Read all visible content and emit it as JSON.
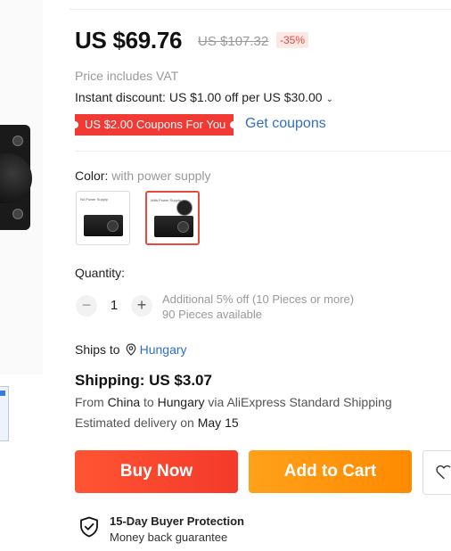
{
  "price": {
    "current": "US $69.76",
    "original": "US $107.32",
    "discount": "-35%",
    "vat_note": "Price includes VAT",
    "instant_discount": "Instant discount: US $1.00 off per US $30.00"
  },
  "coupons": {
    "tag": "US $2.00 Coupons For You",
    "link": "Get coupons"
  },
  "color": {
    "label": "Color:",
    "value": "with power supply",
    "options": [
      {
        "caption": "No Power Supply",
        "selected": false
      },
      {
        "caption": "With Power Supply",
        "selected": true
      }
    ]
  },
  "quantity": {
    "label": "Quantity:",
    "minus": "−",
    "value": "1",
    "plus": "+",
    "note1": "Additional 5% off (10 Pieces or more)",
    "note2": "90 Pieces available"
  },
  "shipping": {
    "ships_to_label": "Ships to",
    "country": "Hungary",
    "cost": "Shipping: US $3.07",
    "route_from": "From ",
    "route_origin": "China",
    "route_to": " to ",
    "route_dest": "Hungary",
    "route_via": " via AliExpress Standard Shipping",
    "delivery_prefix": "Estimated delivery on ",
    "delivery_date": "May 15"
  },
  "actions": {
    "buy_now": "Buy Now",
    "add_to_cart": "Add to Cart"
  },
  "protection": {
    "title": "15-Day Buyer Protection",
    "subtitle": "Money back guarantee"
  },
  "colors": {
    "accent_red": "#f03a33",
    "link_blue": "#2f6ec9",
    "buy_now": "#f4472d",
    "add_to_cart": "#ff960d"
  }
}
